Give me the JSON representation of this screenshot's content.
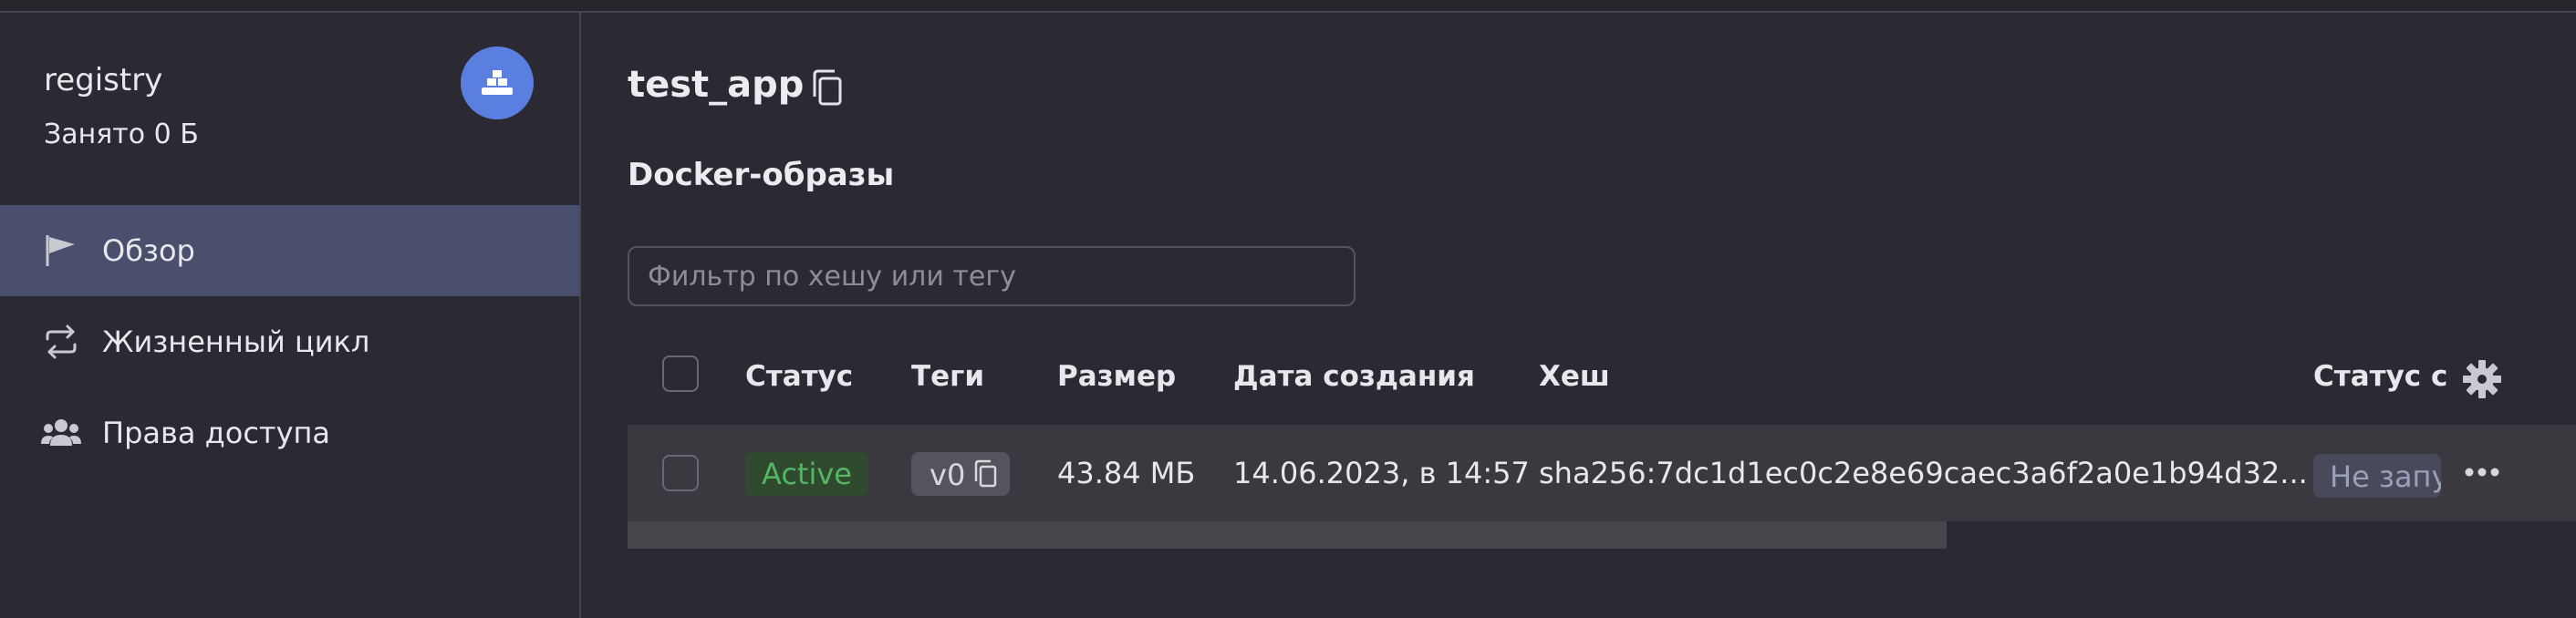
{
  "sidebar": {
    "registry_name": "registry",
    "storage_used": "Занято 0 Б",
    "items": [
      {
        "label": "Обзор",
        "icon": "flag-icon",
        "active": true
      },
      {
        "label": "Жизненный цикл",
        "icon": "cycle-arrows-icon",
        "active": false
      },
      {
        "label": "Права доступа",
        "icon": "users-icon",
        "active": false
      }
    ]
  },
  "main": {
    "title": "test_app",
    "section_title": "Docker-образы",
    "filter": {
      "placeholder": "Фильтр по хешу или тегу",
      "value": ""
    },
    "table": {
      "columns": [
        "Статус",
        "Теги",
        "Размер",
        "Дата создания",
        "Хеш",
        "Статус ск"
      ],
      "rows": [
        {
          "status": "Active",
          "tag": "v0",
          "size": "43.84 МБ",
          "created": "14.06.2023, в 14:57",
          "hash": "sha256:7dc1d1ec0c2e8e69caec3a6f2a0e1b94d32...",
          "scan_status": "Не запу"
        }
      ]
    }
  },
  "colors": {
    "background": "#2b2a33",
    "active_nav": "#4a4f6e",
    "avatar": "#5b7fe0",
    "status_green": "#55b561",
    "row_bg": "#3a3940"
  }
}
